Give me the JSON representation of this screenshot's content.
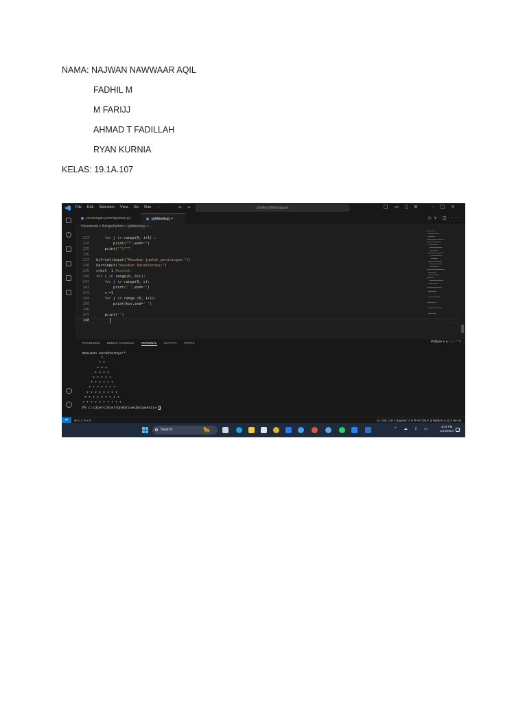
{
  "document": {
    "lines": [
      "NAMA: NAJWAN NAWWAAR AQIL",
      "FADHIL M",
      "M FARIJJ",
      "AHMAD T FADILLAH",
      "RYAN KURNIA",
      "KELAS: 19.1A.107"
    ]
  },
  "screenshot": {
    "menu": [
      "File",
      "Edit",
      "Selection",
      "View",
      "Go",
      "Run",
      "···"
    ],
    "search_placeholder": "Untitled (Workspace)",
    "tabs": [
      {
        "label": "perulangan pemrograman.py",
        "active": false
      },
      {
        "label": "pyhthonll.py",
        "active": true
      }
    ],
    "breadcrumb": "Documents > BelajarPython > pyhthonll.py > ...",
    "code_lines": [
      {
        "n": "233",
        "text": "    for j in range(0, i+1) :"
      },
      {
        "n": "234",
        "text": "        print(\"*\",end=\"\")"
      },
      {
        "n": "235",
        "text": "    print(\"\")\"\"\""
      },
      {
        "n": "236",
        "text": ""
      },
      {
        "n": "237",
        "text": "bil=int(input(\"Masukan jumlah perulangan:\"))"
      },
      {
        "n": "238",
        "text": "kar=input(\"masukan karakternya:\")"
      },
      {
        "n": "239",
        "text": "s=bil- 1 #contoh"
      },
      {
        "n": "240",
        "text": "for i in range(0, bil):"
      },
      {
        "n": "241",
        "text": "    for j in range(0, s):"
      },
      {
        "n": "242",
        "text": "        print(' ',end='')"
      },
      {
        "n": "243",
        "text": "    s-=1"
      },
      {
        "n": "244",
        "text": "    for j in range (0, i+1):"
      },
      {
        "n": "245",
        "text": "        print(kar,end=' ')"
      },
      {
        "n": "246",
        "text": ""
      },
      {
        "n": "247",
        "text": "    print('')"
      },
      {
        "n": "248",
        "text": ""
      }
    ],
    "panel_tabs": [
      "PROBLEMS",
      "DEBUG CONSOLE",
      "TERMINAL",
      "OUTPUT",
      "PORTS"
    ],
    "active_panel_tab": "TERMINAL",
    "panel_actions": "Python  + ∨  □  ···  ^  ×",
    "terminal_lines": [
      "masukan karakternya:*",
      "         *",
      "        * *",
      "       * * *",
      "      * * * *",
      "     * * * * *",
      "    * * * * * *",
      "   * * * * * * *",
      "  * * * * * * * *",
      " * * * * * * * * *",
      "* * * * * * * * * *"
    ],
    "terminal_prompt": "PS C:\\Users\\User\\OneDrive\\Documents> ",
    "status_left": "⊗ 0 ⚠ 0   ⑂ 0",
    "status_right": "Ln 248, Col 1   Spaces: 4   UTF-8   CRLF   {} Python   3.12.2 64-bit",
    "taskbar": {
      "search_label": "Search",
      "time": "3:03 PM",
      "date": "4/24/2024"
    },
    "colors": {
      "editor_bg": "#1e1e1e",
      "keyword": "#c586c0",
      "function": "#dcdcaa",
      "string": "#ce9178",
      "number": "#b5cea8",
      "comment": "#6a9955",
      "accent": "#0078d4"
    }
  }
}
